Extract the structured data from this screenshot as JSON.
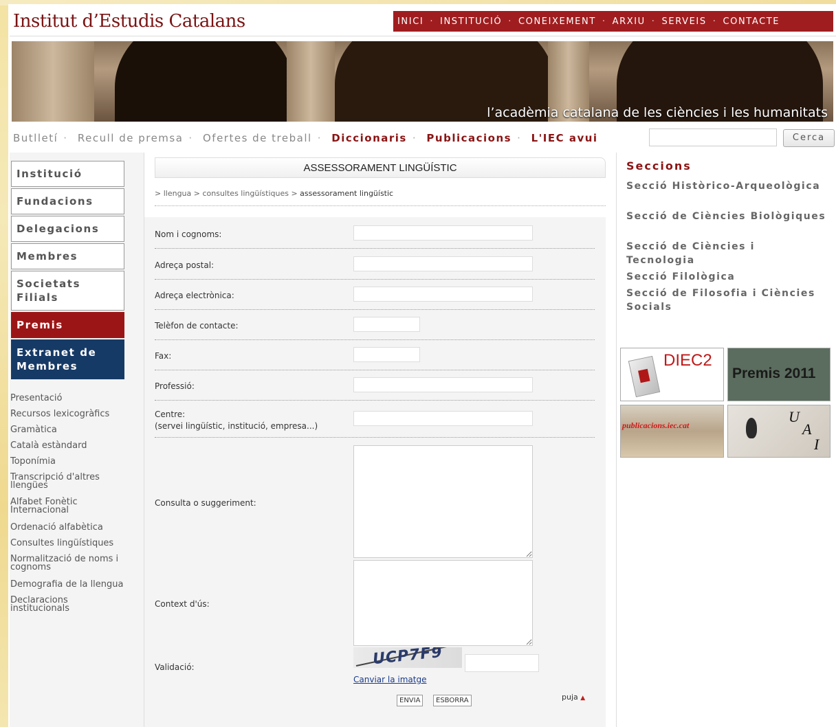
{
  "site": {
    "logo": "Institut d’Estudis Catalans",
    "tagline": "l’acadèmia catalana de les ciències i les humanitats"
  },
  "topnav": [
    "INICI",
    "INSTITUCIÓ",
    "CONEIXEMENT",
    "ARXIU",
    "SERVEIS",
    "CONTACTE"
  ],
  "subnav": {
    "items": [
      {
        "label": "Butlletí",
        "bold": false
      },
      {
        "label": "Recull de premsa",
        "bold": false
      },
      {
        "label": "Ofertes de treball",
        "bold": false
      },
      {
        "label": "Diccionaris",
        "bold": true
      },
      {
        "label": "Publicacions",
        "bold": true
      },
      {
        "label": "L'IEC avui",
        "bold": true
      }
    ],
    "search_button": "Cerca",
    "search_value": ""
  },
  "sidebar": {
    "buttons": [
      "Institució",
      "Fundacions",
      "Delegacions",
      "Membres",
      "Societats Filials",
      "Premis",
      "Extranet de Membres"
    ],
    "links": [
      "Presentació",
      "Recursos lexicogràfics",
      "Gramàtica",
      "Català estàndard",
      "Toponímia",
      "Transcripció d'altres llengües",
      "Alfabet Fonètic Internacional",
      "Ordenació alfabètica",
      "Consultes lingüístiques",
      "Normalització de noms i cognoms",
      "Demografia de la llengua",
      "Declaracions institucionals"
    ]
  },
  "main": {
    "title": "ASSESSORAMENT LINGÜÍSTIC",
    "breadcrumb": [
      "llengua",
      "consultes lingüístiques",
      "assessorament lingüístic"
    ],
    "fields": {
      "nom": "Nom i cognoms:",
      "adreca": "Adreça postal:",
      "email": "Adreça electrònica:",
      "telefon": "Telèfon de contacte:",
      "fax": "Fax:",
      "professio": "Professió:",
      "centre": "Centre:",
      "centre_hint": "(servei lingüístic, institució, empresa...)",
      "consulta": "Consulta o suggeriment:",
      "context": "Context d'ús:",
      "validacio": "Validació:"
    },
    "captcha_text": "UCP7F9",
    "change_image": "Canviar la imatge",
    "send": "ENVIA",
    "clear": "ESBORRA",
    "top": "puja"
  },
  "right": {
    "title": "Seccions",
    "sections": [
      "Secció Històrico-Arqueològica",
      "Secció de Ciències Biològiques",
      "Secció de Ciències i Tecnologia",
      "Secció Filològica",
      "Secció de Filosofia i Ciències Socials"
    ],
    "promos": {
      "diec": "DIEC2",
      "premis": "Premis 2011",
      "publicacions": "publicacions.iec.cat",
      "uai_u": "U",
      "uai_a": "A",
      "uai_i": "I"
    }
  }
}
